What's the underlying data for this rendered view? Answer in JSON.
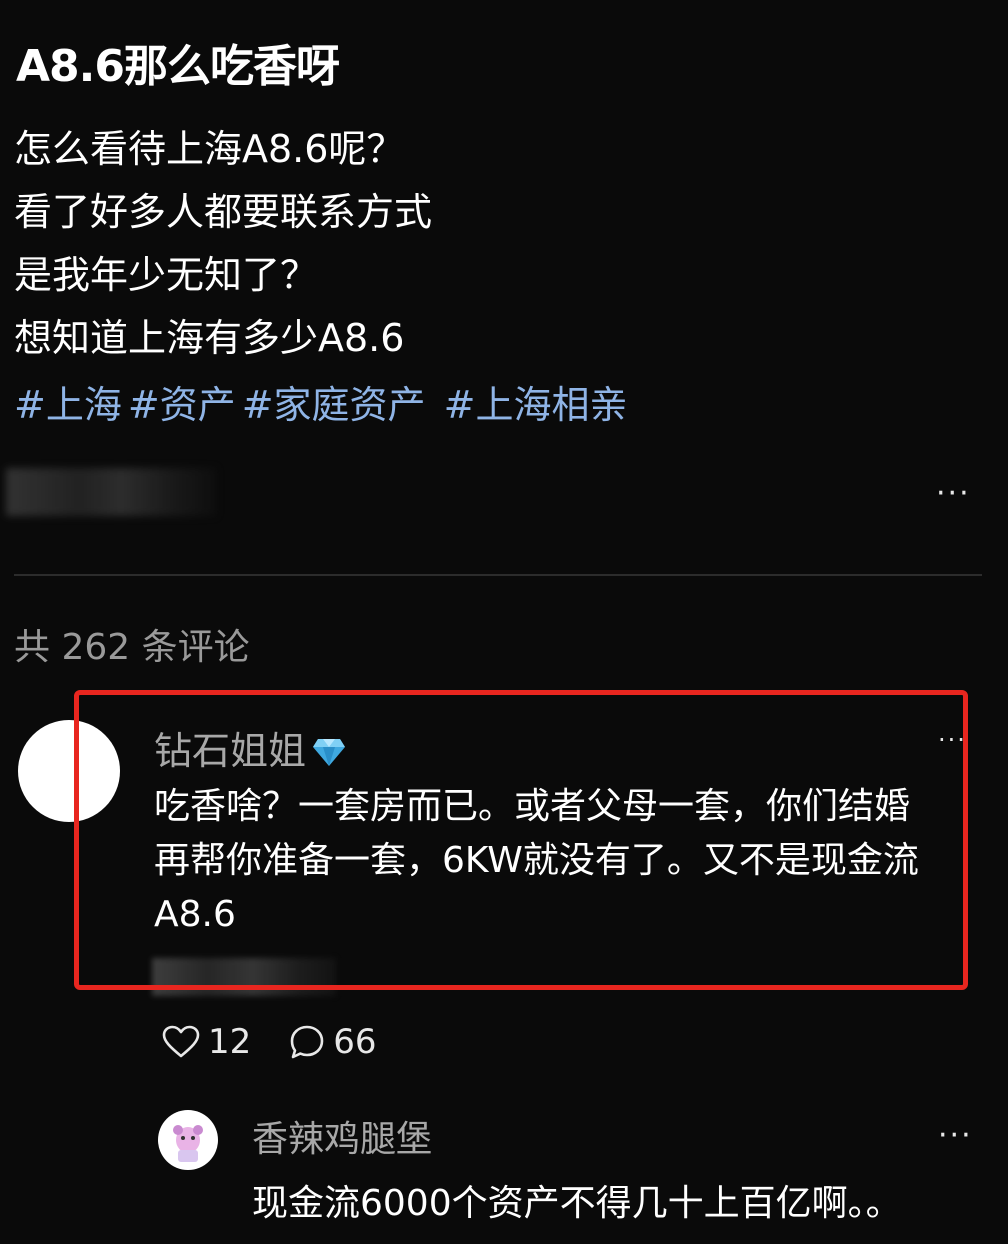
{
  "post": {
    "title": "A8.6那么吃香呀",
    "lines": [
      "怎么看待上海A8.6呢？",
      "看了好多人都要联系方式",
      "是我年少无知了？",
      "想知道上海有多少A8.6"
    ],
    "tags": [
      "#上海",
      "#资产",
      "#家庭资产",
      "#上海相亲"
    ],
    "more_label": "···"
  },
  "comments_header": "共 262 条评论",
  "colors": {
    "background": "#0a0a0a",
    "tag": "#8fb4e6",
    "highlight": "#e8261f",
    "muted": "#a8a8a8"
  },
  "comments": [
    {
      "user": "钻石姐姐",
      "badge_icon": "diamond-icon",
      "text_lines": [
        "吃香啥？一套房而已。或者父母一套，你们结婚",
        "再帮你准备一套，6KW就没有了。又不是现金流",
        "A8.6"
      ],
      "more_label": "···",
      "likes": "12",
      "replies": "66"
    },
    {
      "user": "香辣鸡腿堡",
      "text": "现金流6000个资产不得几十上百亿啊。。",
      "more_label": "···"
    }
  ]
}
